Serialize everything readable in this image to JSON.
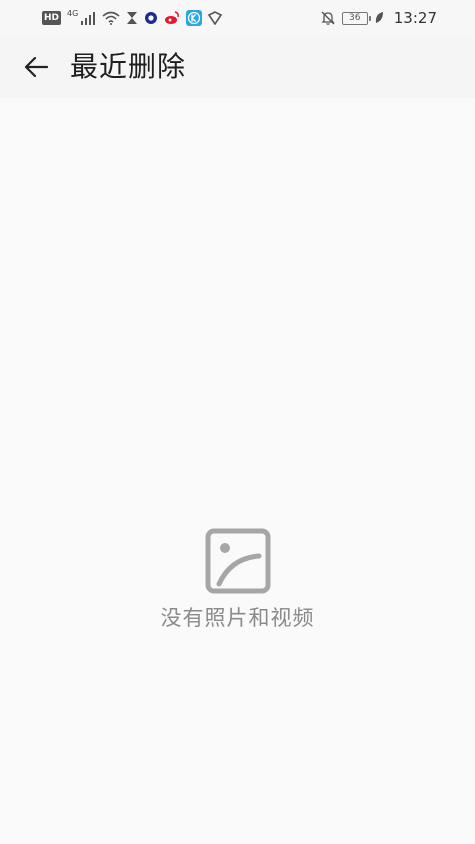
{
  "status_bar": {
    "hd_label": "HD",
    "network_label": "4G",
    "battery_level": "36",
    "time": "13:27"
  },
  "header": {
    "title": "最近删除"
  },
  "empty_state": {
    "message": "没有照片和视频"
  }
}
